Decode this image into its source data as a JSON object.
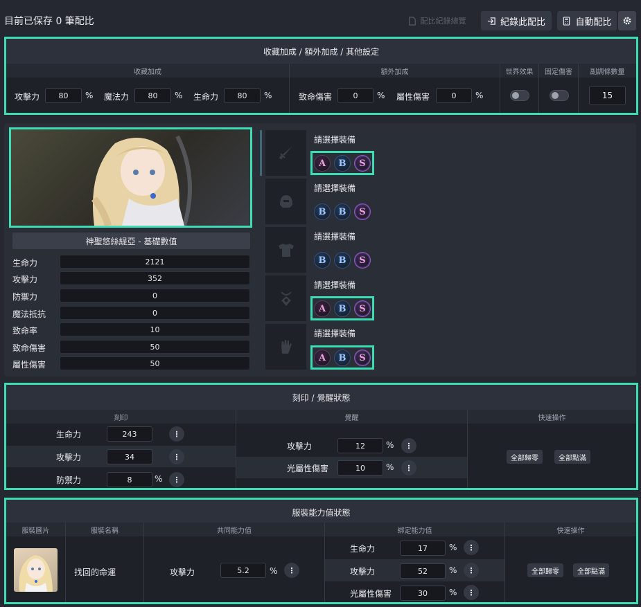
{
  "top": {
    "title": "目前已保存 0 筆配比",
    "history_label": "配比紀錄總覽",
    "record_label": "紀錄此配比",
    "auto_label": "自動配比"
  },
  "settings": {
    "header": "收藏加成 / 額外加成 / 其他設定",
    "collection_head": "收藏加成",
    "extra_head": "額外加成",
    "world_head": "世界效果",
    "fixed_head": "固定傷害",
    "tuning_head": "副調條數量",
    "atk_label": "攻擊力",
    "atk_value": "80",
    "mag_label": "魔法力",
    "mag_value": "80",
    "hp_label": "生命力",
    "hp_value": "80",
    "crit_dmg_label": "致命傷害",
    "crit_dmg_value": "0",
    "attr_dmg_label": "屬性傷害",
    "attr_dmg_value": "0",
    "tuning_value": "15",
    "pct": "%"
  },
  "character": {
    "name": "神聖悠絲緹亞 - 基礎數值",
    "stats": [
      {
        "label": "生命力",
        "value": "2121"
      },
      {
        "label": "攻擊力",
        "value": "352"
      },
      {
        "label": "防禦力",
        "value": "0"
      },
      {
        "label": "魔法抵抗",
        "value": "0"
      },
      {
        "label": "致命率",
        "value": "10"
      },
      {
        "label": "致命傷害",
        "value": "50"
      },
      {
        "label": "屬性傷害",
        "value": "50"
      }
    ]
  },
  "equipment": {
    "slots": [
      {
        "label": "請選擇裝備",
        "icon": "sword-icon",
        "ranks": [
          "A",
          "B",
          "S"
        ]
      },
      {
        "label": "請選擇裝備",
        "icon": "helmet-icon",
        "ranks": [
          "B",
          "B",
          "S"
        ]
      },
      {
        "label": "請選擇裝備",
        "icon": "armor-icon",
        "ranks": [
          "B",
          "B",
          "S"
        ]
      },
      {
        "label": "請選擇裝備",
        "icon": "amulet-icon",
        "ranks": [
          "A",
          "B",
          "S"
        ]
      },
      {
        "label": "請選擇裝備",
        "icon": "glove-icon",
        "ranks": [
          "A",
          "B",
          "S"
        ]
      }
    ]
  },
  "engrave": {
    "header": "刻印 / 覺醒狀態",
    "engrave_head": "刻印",
    "awaken_head": "覺醒",
    "quick_head": "快速操作",
    "engrave_rows": [
      {
        "label": "生命力",
        "value": "243",
        "pct": ""
      },
      {
        "label": "攻擊力",
        "value": "34",
        "pct": ""
      },
      {
        "label": "防禦力",
        "value": "8",
        "pct": "%"
      }
    ],
    "awaken_rows": [
      {
        "label": "攻擊力",
        "value": "12",
        "pct": "%"
      },
      {
        "label": "光屬性傷害",
        "value": "10",
        "pct": "%"
      }
    ],
    "reset_label": "全部歸零",
    "max_label": "全部點滿"
  },
  "costume": {
    "header": "服裝能力值狀態",
    "image_head": "服裝圖片",
    "name_head": "服裝名稱",
    "common_head": "共同能力值",
    "bind_head": "綁定能力值",
    "quick_head": "快速操作",
    "name": "找回的命運",
    "common_label": "攻擊力",
    "common_value": "5.2",
    "common_pct": "%",
    "bind_rows": [
      {
        "label": "生命力",
        "value": "17",
        "pct": "%"
      },
      {
        "label": "攻擊力",
        "value": "52",
        "pct": "%"
      },
      {
        "label": "光屬性傷害",
        "value": "30",
        "pct": "%"
      }
    ],
    "reset_label": "全部歸零",
    "max_label": "全部點滿"
  }
}
